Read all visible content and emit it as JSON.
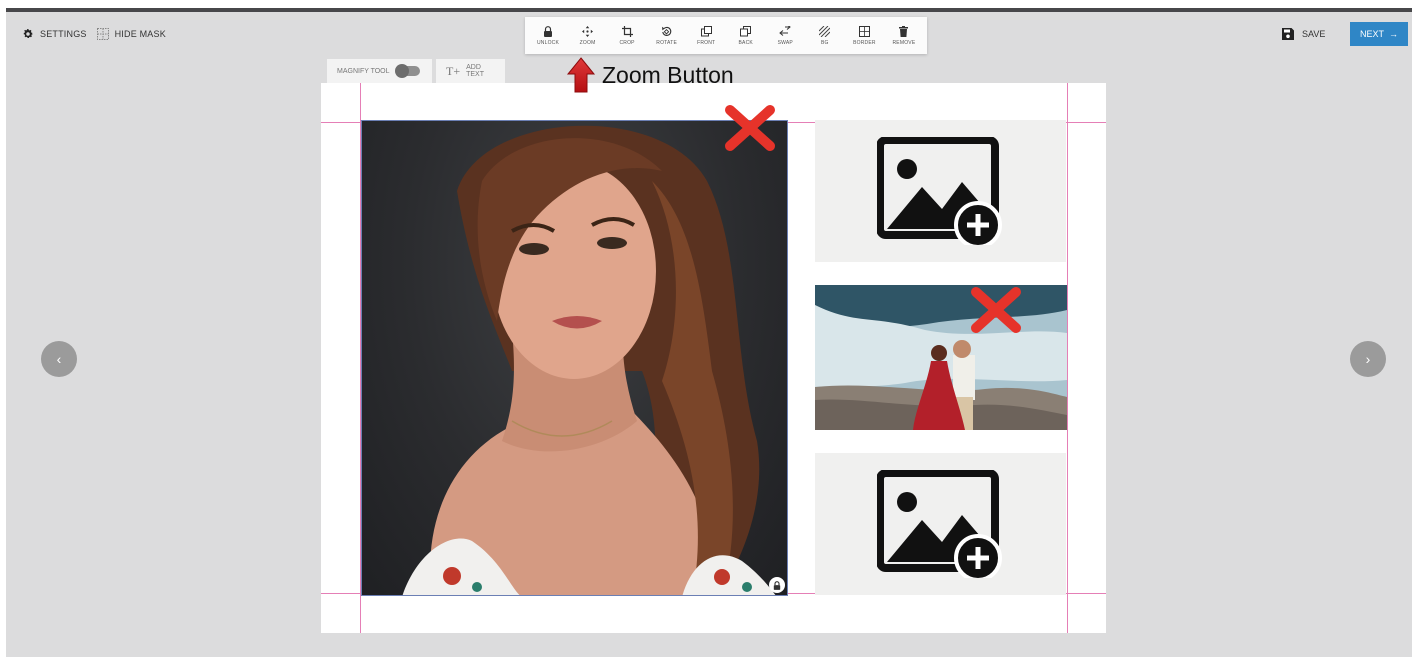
{
  "header": {
    "settings_label": "SETTINGS",
    "hide_mask_label": "HIDE MASK",
    "save_label": "SAVE",
    "next_label": "NEXT",
    "next_arrow": "→"
  },
  "toolbar": {
    "items": [
      {
        "label": "UNLOCK",
        "icon": "lock-icon"
      },
      {
        "label": "ZOOM",
        "icon": "move-arrows-icon"
      },
      {
        "label": "CROP",
        "icon": "crop-icon"
      },
      {
        "label": "ROTATE",
        "icon": "rotate-icon"
      },
      {
        "label": "FRONT",
        "icon": "bring-front-icon"
      },
      {
        "label": "BACK",
        "icon": "send-back-icon"
      },
      {
        "label": "SWAP",
        "icon": "swap-icon"
      },
      {
        "label": "BG",
        "icon": "background-icon"
      },
      {
        "label": "BORDER",
        "icon": "border-icon"
      },
      {
        "label": "REMOVE",
        "icon": "trash-icon"
      }
    ]
  },
  "canvas_tabs": {
    "magnify_label": "MAGNIFY TOOL",
    "add_text_label": "ADD TEXT",
    "add_text_glyph": "T+"
  },
  "annotation": {
    "label": "Zoom Button"
  },
  "navigation": {
    "prev_glyph": "‹",
    "next_glyph": "›"
  },
  "colors": {
    "accent": "#2f86c6",
    "guide": "#e57fb6",
    "delete_mark": "#e6332a",
    "canvas_bg": "#dcdcdd"
  }
}
